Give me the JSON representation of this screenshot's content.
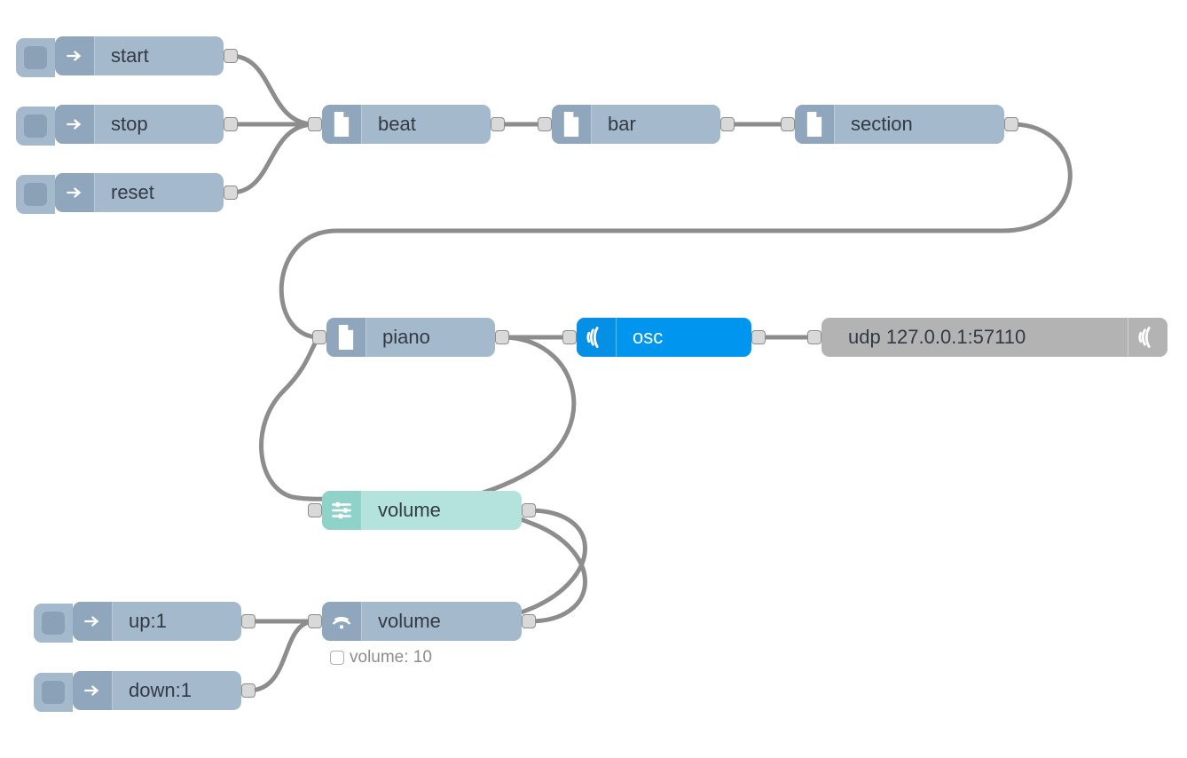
{
  "nodes": {
    "start": {
      "label": "start"
    },
    "stop": {
      "label": "stop"
    },
    "reset": {
      "label": "reset"
    },
    "beat": {
      "label": "beat"
    },
    "bar": {
      "label": "bar"
    },
    "section": {
      "label": "section"
    },
    "piano": {
      "label": "piano"
    },
    "osc": {
      "label": "osc"
    },
    "udp": {
      "label": "udp 127.0.0.1:57110"
    },
    "volumeSlider": {
      "label": "volume"
    },
    "volumeLink": {
      "label": "volume"
    },
    "up": {
      "label": "up:1"
    },
    "down": {
      "label": "down:1"
    },
    "status": {
      "text": "volume: 10"
    }
  },
  "icons": {
    "arrow": "inject-arrow-icon",
    "file": "file-icon",
    "osc": "osc-wave-icon",
    "slider": "sliders-icon",
    "link": "link-wave-icon"
  },
  "wires": [
    [
      "start-out",
      "beat-in"
    ],
    [
      "stop-out",
      "beat-in"
    ],
    [
      "reset-out",
      "beat-in"
    ],
    [
      "beat-out",
      "bar-in"
    ],
    [
      "bar-out",
      "section-in"
    ],
    [
      "section-out",
      "piano-in"
    ],
    [
      "piano-out",
      "osc-in"
    ],
    [
      "osc-out",
      "udp-in"
    ],
    [
      "piano-out",
      "volumeSlider-in"
    ],
    [
      "volumeSlider-out",
      "volumeLink-in"
    ],
    [
      "volumeLink-out",
      "piano-in"
    ],
    [
      "up-out",
      "volumeLink-in"
    ],
    [
      "down-out",
      "volumeLink-in"
    ]
  ]
}
